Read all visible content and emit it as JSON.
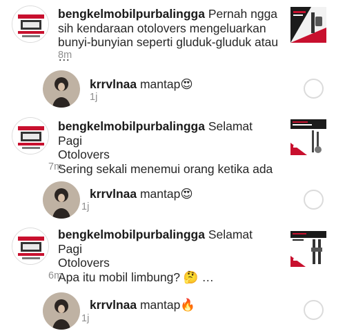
{
  "notifications": [
    {
      "username": "bengkelmobilpurbalingga",
      "lines": [
        "Pernah ngga",
        "sih kendaraan otolovers mengeluarkan",
        "bunyi-bunyian seperti gluduk-gluduk atau …"
      ],
      "time": "8m",
      "avatar_icon": "shop-logo-icon",
      "thumbnail_icon": "car-part-post-thumbnail"
    },
    {
      "username": "krrvlnaa",
      "comment": "mantap",
      "emoji": "😍",
      "time": "1j",
      "avatar_icon": "user-avatar-icon"
    },
    {
      "username": "bengkelmobilpurbalingga",
      "lines": [
        "Selamat Pagi",
        "Otolovers",
        "Sering sekali menemui orang ketika ada …"
      ],
      "time": "7m",
      "avatar_icon": "shop-logo-icon",
      "thumbnail_icon": "car-part-post-thumbnail"
    },
    {
      "username": "krrvlnaa",
      "comment": "mantap",
      "emoji": "😍",
      "time": "1j",
      "avatar_icon": "user-avatar-icon"
    },
    {
      "username": "bengkelmobilpurbalingga",
      "lines": [
        "Selamat Pagi",
        "Otolovers",
        "Apa itu mobil limbung? 🤔 …"
      ],
      "time": "6m",
      "avatar_icon": "shop-logo-icon",
      "thumbnail_icon": "car-part-post-thumbnail"
    },
    {
      "username": "krrvlnaa",
      "comment": "mantap",
      "emoji": "🔥",
      "time": "1j",
      "avatar_icon": "user-avatar-icon"
    }
  ],
  "colors": {
    "text": "#262626",
    "muted": "#8e8e8e",
    "brand_red": "#c8102e",
    "circle_border": "#dbdbdb"
  }
}
